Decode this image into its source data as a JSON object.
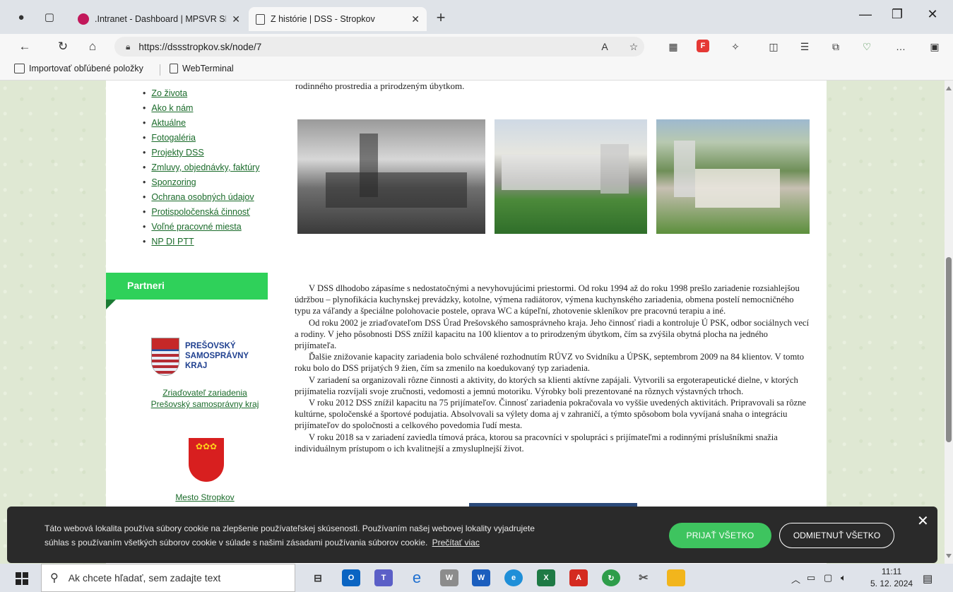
{
  "browser": {
    "tabs": [
      {
        "title": ".Intranet - Dashboard | MPSVR SR",
        "active": false
      },
      {
        "title": "Z histórie | DSS - Stropkov",
        "active": true
      }
    ],
    "url": "https://dssstropkov.sk/node/7",
    "favorites": [
      "Importovať obľúbené položky",
      "WebTerminal"
    ]
  },
  "page": {
    "menu": [
      "Zo života",
      "Ako k nám",
      "Aktuálne",
      "Fotogaléria",
      "Projekty DSS",
      "Zmluvy, objednávky, faktúry",
      "Sponzoring",
      "Ochrana osobných údajov",
      "Protispoločenská činnosť",
      "Voľné pracovné miesta",
      "NP DI PTT"
    ],
    "intro_text": "rodinného prostredia a prirodzeným úbytkom.",
    "partners": {
      "heading": "Partneri",
      "psk_logo_lines": [
        "PREŠOVSKÝ",
        "SAMOSPRÁVNY",
        "KRAJ"
      ],
      "psk_link_line1": "Zriaďovateľ zariadenia",
      "psk_link_line2": "Prešovský samosprávny kraj",
      "mesto_link": "Mesto Stropkov"
    },
    "paragraphs": [
      "V DSS dlhodobo zápasíme s nedostatočnými a nevyhovujúcimi priestormi. Od roku 1994 až do roku 1998 prešlo zariadenie rozsiahlejšou údržbou – plynofikácia kuchynskej prevádzky, kotolne, výmena radiátorov, výmena kuchynského zariadenia, obmena postelí nemocničného typu za váľandy a špeciálne polohovacie postele, oprava WC a kúpeľní, zhotovenie skleníkov pre pracovnú terapiu a iné.",
      "Od roku 2002 je zriaďovateľom DSS Úrad Prešovského samosprávneho kraja. Jeho činnosť riadi a kontroluje Ú PSK, odbor sociálnych vecí a rodiny. V jeho pôsobnosti DSS znížil kapacitu na 100 klientov a to prirodzeným úbytkom, čím sa zvýšila obytná plocha na jedného prijímateľa.",
      "Ďalšie znižovanie kapacity zariadenia bolo schválené rozhodnutím RÚVZ vo Svidníku a ÚPSK, septembrom 2009 na 84 klientov. V tomto roku bolo do DSS  prijatých 9 žien, čím sa zmenilo na koedukovaný typ zariadenia.",
      "V zariadení sa organizovali rôzne činnosti a aktivity, do ktorých sa klienti aktívne zapájali. Vytvorili sa ergoterapeutické dielne, v ktorých prijímatelia rozvíjali svoje zručnosti, vedomosti a jemnú motoriku. Výrobky boli prezentované na rôznych výstavných trhoch.",
      "V roku 2012 DSS znížil kapacitu na 75 prijímateľov. Činnosť zariadenia pokračovala vo vyššie uvedených aktivitách. Pripravovali sa rôzne kultúrne, spoločenské a športové podujatia. Absolvovali sa výlety doma aj v zahraničí, a týmto spôsobom bola vyvíjaná snaha o integráciu prijímateľov do spoločnosti a celkového povedomia ľudí mesta.",
      "V roku 2018 sa v zariadení zaviedla tímová práca, ktorou sa pracovníci v spolupráci s prijímateľmi a rodinnými príslušníkmi snažia individuálnym prístupom o ich kvalitnejší a zmysluplnejší život."
    ]
  },
  "cookie": {
    "line1": "Táto webová lokalita používa súbory cookie na zlepšenie používateľskej skúsenosti. Používaním našej webovej lokality vyjadrujete",
    "line2": "súhlas s používaním všetkých súborov cookie v súlade s našimi zásadami používania súborov cookie.",
    "read_more": "Prečítať viac",
    "accept": "PRIJAŤ VŠETKO",
    "reject": "ODMIETNUŤ VŠETKO"
  },
  "taskbar": {
    "search_placeholder": "Ak chcete hľadať, sem zadajte text",
    "time": "11:11",
    "date": "5. 12. 2024"
  }
}
